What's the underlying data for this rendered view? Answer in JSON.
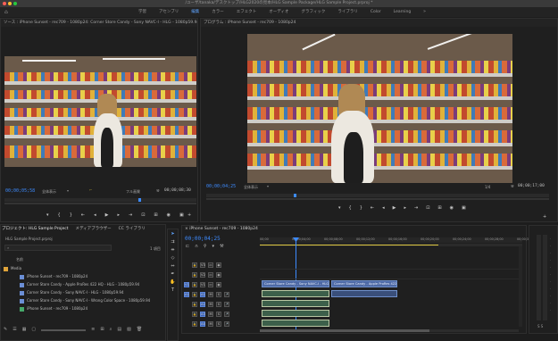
{
  "window": {
    "title": "/ユーザ/tanaka/デスクトップ/HLG2020の見本/HLG Sample Package/HLG Sample Project.prproj *"
  },
  "workspace": {
    "tabs": [
      "学習",
      "アセンブリ",
      "編集",
      "カラー",
      "エフェクト",
      "オーディオ",
      "グラフィック",
      "ライブラリ",
      "Color",
      "Learning"
    ],
    "active_tab": "編集",
    "more": "»"
  },
  "source": {
    "title": "ソース : iPhone Sunset - rec709 - 1080p24: Corner Store Candy - Sony NAVC-I - HLG - 1080p59.94: 00;00;00;00",
    "timecode_left": "00;00;05;58",
    "fit": "全体表示",
    "res": "フル画質",
    "timecode_right": "00;00;08;30"
  },
  "program": {
    "title": "プログラム : iPhone Sunset - rec709 - 1080p24",
    "timecode_left": "00;00;04;25",
    "fit": "全体表示",
    "res": "1/4",
    "timecode_right": "00;00;17;00"
  },
  "project": {
    "tabs": [
      "プロジェクト: HLG Sample Project",
      "メディアブラウザー",
      "CC ライブラリ"
    ],
    "file": "HLG Sample Project.prproj",
    "item_count": "1 項目",
    "column_name": "名前",
    "items": [
      {
        "label": "Media",
        "color": "#e0a43a",
        "type": "folder"
      },
      {
        "label": "iPhone Sunset - rec709 - 1080p24",
        "color": "#6b8fd6",
        "type": "clip"
      },
      {
        "label": "Corner Store Candy - Apple ProRes 422 HQ - HLG - 1080p59.94",
        "color": "#6b8fd6",
        "type": "clip"
      },
      {
        "label": "Corner Store Candy - Sony NAVC-I - HLG - 1080p59.94",
        "color": "#6b8fd6",
        "type": "clip"
      },
      {
        "label": "Corner Store Candy - Sony NAVC-I - Wrong Color Space - 1080p59.94",
        "color": "#6b8fd6",
        "type": "clip"
      },
      {
        "label": "iPhone Sunset - rec709 - 1080p24",
        "color": "#46a86a",
        "type": "sequence"
      }
    ]
  },
  "timeline": {
    "tab": "iPhone Sunset - rec709 - 1080p24",
    "timecode": "00;00;04;25",
    "ruler_labels": [
      "00;00",
      "00;00;04;00",
      "00;00;08;00",
      "00;00;12;00",
      "00;00;16;00",
      "00;00;20;00",
      "00;00;24;00",
      "00;00;28;00",
      "00;00;32;00"
    ],
    "video_tracks": [
      "V3",
      "V2",
      "V1"
    ],
    "audio_tracks": [
      "A1",
      "A2",
      "A3",
      "A4"
    ],
    "clips": [
      {
        "label": "Corner Store Candy - Sony NAVC-I - HLG - 1080p59.94",
        "track": "V1"
      },
      {
        "label": "Corner Store Candy - Apple ProRes 422",
        "track": "V1"
      }
    ]
  },
  "colors": {
    "accent": "#3d8bff",
    "video_clip": "#4e6aa6",
    "audio_clip": "#3c5f4a"
  }
}
